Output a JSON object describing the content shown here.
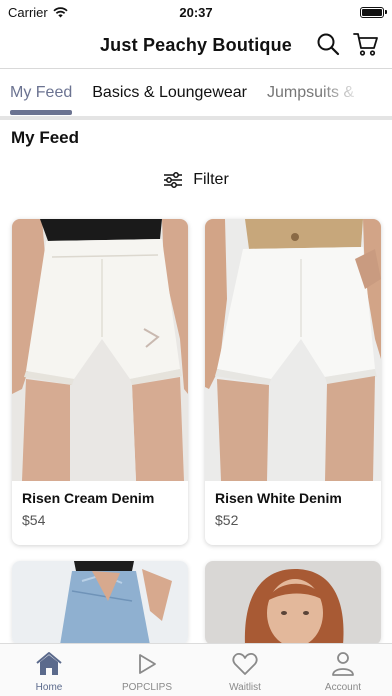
{
  "status_bar": {
    "carrier": "Carrier",
    "time": "20:37",
    "battery_level": 1.0
  },
  "header": {
    "title": "Just Peachy Boutique",
    "icons": [
      "search-icon",
      "cart-icon"
    ]
  },
  "tabs": [
    {
      "label": "My Feed",
      "active": true
    },
    {
      "label": "Basics & Loungewear",
      "active": false
    },
    {
      "label": "Jumpsuits &",
      "active": false
    }
  ],
  "section_title": "My Feed",
  "filter": {
    "label": "Filter",
    "icon": "sliders-icon"
  },
  "products": [
    {
      "name": "Risen Cream Denim",
      "price": "$54"
    },
    {
      "name": "Risen White Denim",
      "price": "$52"
    }
  ],
  "bottom_nav": [
    {
      "label": "Home",
      "icon": "home-icon",
      "active": true
    },
    {
      "label": "POPCLIPS",
      "icon": "play-icon",
      "active": false
    },
    {
      "label": "Waitlist",
      "icon": "heart-icon",
      "active": false
    },
    {
      "label": "Account",
      "icon": "person-icon",
      "active": false
    }
  ],
  "colors": {
    "accent": "#6b7391",
    "nav_active": "#5b6a8c",
    "nav_inactive": "#8a8a8a"
  }
}
